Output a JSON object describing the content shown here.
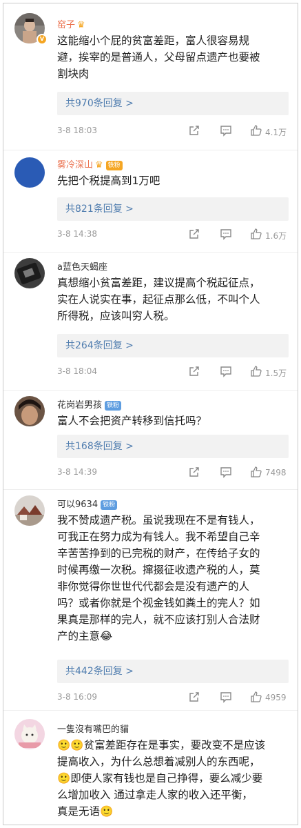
{
  "comments": [
    {
      "user": "窑子",
      "text_lines": [
        "这能缩小个屁的贫富差距，富人很容易规",
        "避，挨宰的是普通人，父母留点遗产也要被",
        "割块肉"
      ],
      "replies": "共970条回复 >",
      "date": "3-8 18:03",
      "likes": "4.1万"
    },
    {
      "user": "雾冷深山",
      "badge": "铁粉",
      "text_lines": [
        "先把个税提高到1万吧"
      ],
      "replies": "共821条回复 >",
      "date": "3-8 14:38",
      "likes": "1.6万"
    },
    {
      "user": "a蓝色天蝎座",
      "text_lines": [
        "真想缩小贫富差距，建议提高个税起征点，",
        "实在人说实在事，起征点那么低，不叫个人",
        "所得税，应该叫穷人税。"
      ],
      "replies": "共264条回复 >",
      "date": "3-8 18:04",
      "likes": "1.5万"
    },
    {
      "user": "花岗岩男孩",
      "badge": "铁粉",
      "text_lines": [
        "富人不会把资产转移到信托吗？"
      ],
      "replies": "共168条回复 >",
      "date": "3-8 14:39",
      "likes": "7498"
    },
    {
      "user": "可以9634",
      "badge": "铁粉",
      "text_lines": [
        "我不赞成遗产税。虽说我现在不是有钱人，",
        "可我正在努力成为有钱人。我不希望自己辛",
        "辛苦苦挣到的已完税的财产，在传给子女的",
        "时候再缴一次税。撺掇征收遗产税的人，莫",
        "非你觉得你世世代代都会是没有遗产的人",
        "吗？或者你就是个视金钱如粪土的完人？如",
        "果真是那样的完人，就不应该打别人合法财",
        "产的主意😂"
      ],
      "replies": "共442条回复 >",
      "date": "3-8 16:09",
      "likes": "4959"
    },
    {
      "user": "一隻沒有嘴巴的貓",
      "text_lines": [
        "🙂🙂贫富差距存在是事实，要改变不是应该",
        "提高收入，为什么总想着减别人的东西呢，",
        "🙂即使人家有钱也是自己挣得，要么减少要",
        "么增加收入 通过拿走人家的收入还平衡，",
        "真是无语🙂"
      ]
    }
  ],
  "colors": {
    "orange_name": "#eb7350",
    "link_blue": "#507daf",
    "gray_text": "#999999",
    "reply_bg": "#f2f2f2",
    "fan_badge": "#5e9de0"
  },
  "icons": [
    "share-icon",
    "comment-icon",
    "like-thumb-icon",
    "verified-v-icon",
    "crown-icon"
  ]
}
